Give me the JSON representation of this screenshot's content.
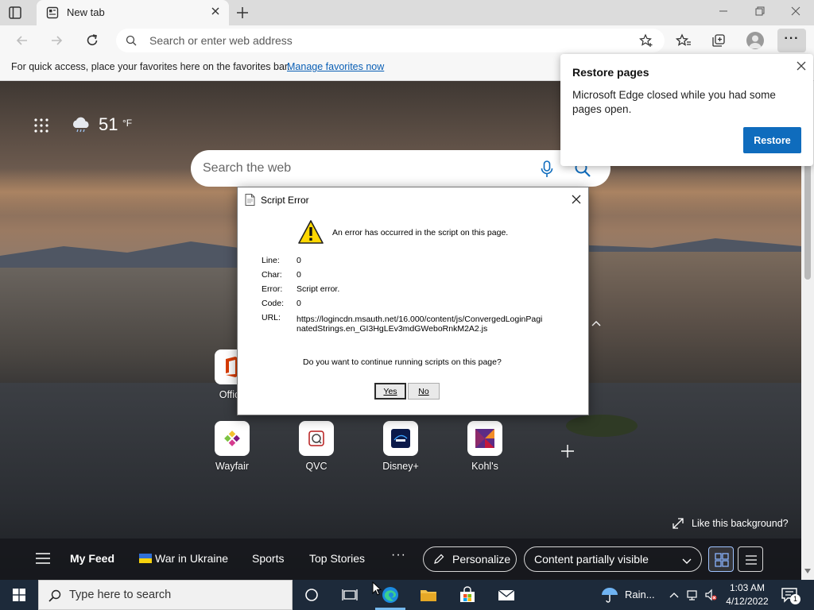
{
  "browser": {
    "tab": {
      "title": "New tab"
    },
    "address": {
      "placeholder": "Search or enter web address"
    },
    "more_label": "···",
    "favorites_bar": {
      "text": "For quick access, place your favorites here on the favorites bar.",
      "link": "Manage favorites now"
    }
  },
  "ntp": {
    "weather": {
      "temp": "51",
      "unit": "°F"
    },
    "search": {
      "placeholder": "Search the web"
    },
    "quicklinks": [
      {
        "label": "Office"
      },
      {
        "label": "Wayfair"
      },
      {
        "label": "QVC"
      },
      {
        "label": "Disney+"
      },
      {
        "label": "Kohl's"
      }
    ],
    "like_background": "Like this background?",
    "feed": {
      "tabs": [
        "My Feed",
        "War in Ukraine",
        "Sports",
        "Top Stories"
      ],
      "more": "···",
      "personalize": "Personalize",
      "content_visibility": "Content partially visible"
    }
  },
  "restore": {
    "title": "Restore pages",
    "body": "Microsoft Edge closed while you had some pages open.",
    "button": "Restore"
  },
  "dialog": {
    "title": "Script Error",
    "message": "An error has occurred in the script on this page.",
    "fields": [
      {
        "label": "Line:",
        "value": "0"
      },
      {
        "label": "Char:",
        "value": "0"
      },
      {
        "label": "Error:",
        "value": "Script error."
      },
      {
        "label": "Code:",
        "value": "0"
      }
    ],
    "url_label": "URL:",
    "url": "https://logincdn.msauth.net/16.000/content/js/ConvergedLoginPaginatedStrings.en_GI3HgLEv3mdGWeboRnkM2A2.js",
    "question": "Do you want to continue running scripts on this page?",
    "yes": "Yes",
    "no": "No"
  },
  "taskbar": {
    "search_placeholder": "Type here to search",
    "weather": "Rain...",
    "time": "1:03 AM",
    "date": "4/12/2022",
    "notification_count": "1"
  },
  "colors": {
    "accent": "#0f6cbd",
    "taskbar": "#1d2a3a",
    "link": "#0a5fb5"
  }
}
